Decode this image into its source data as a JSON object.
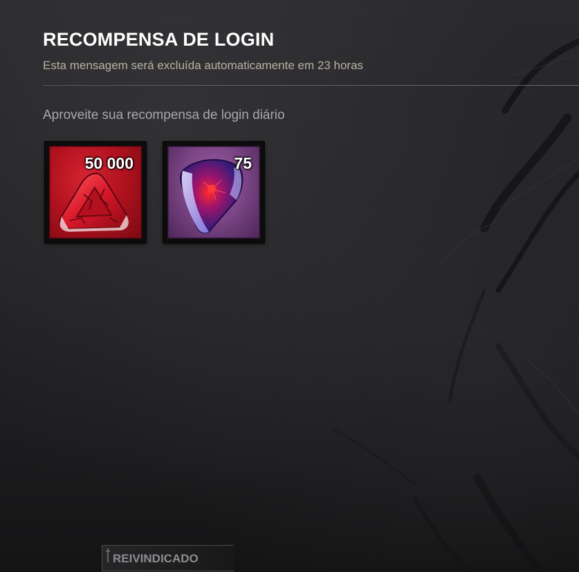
{
  "message": {
    "title": "RECOMPENSA DE LOGIN",
    "subtitle": "Esta mensagem será excluída automaticamente em 23 horas",
    "body": "Aproveite sua recompensa de login diário"
  },
  "rewards": [
    {
      "icon": "bloodpoints-icon",
      "amount": "50 000",
      "color": "#b3121f"
    },
    {
      "icon": "iridescent-shard-icon",
      "amount": "75",
      "color": "#7a4485"
    }
  ],
  "claim_button": {
    "label": "REIVINDICADO",
    "state": "claimed"
  },
  "colors": {
    "background": "#222224",
    "title": "#ffffff",
    "subtitle": "#b9b1a2",
    "body": "#a9a9ab"
  }
}
